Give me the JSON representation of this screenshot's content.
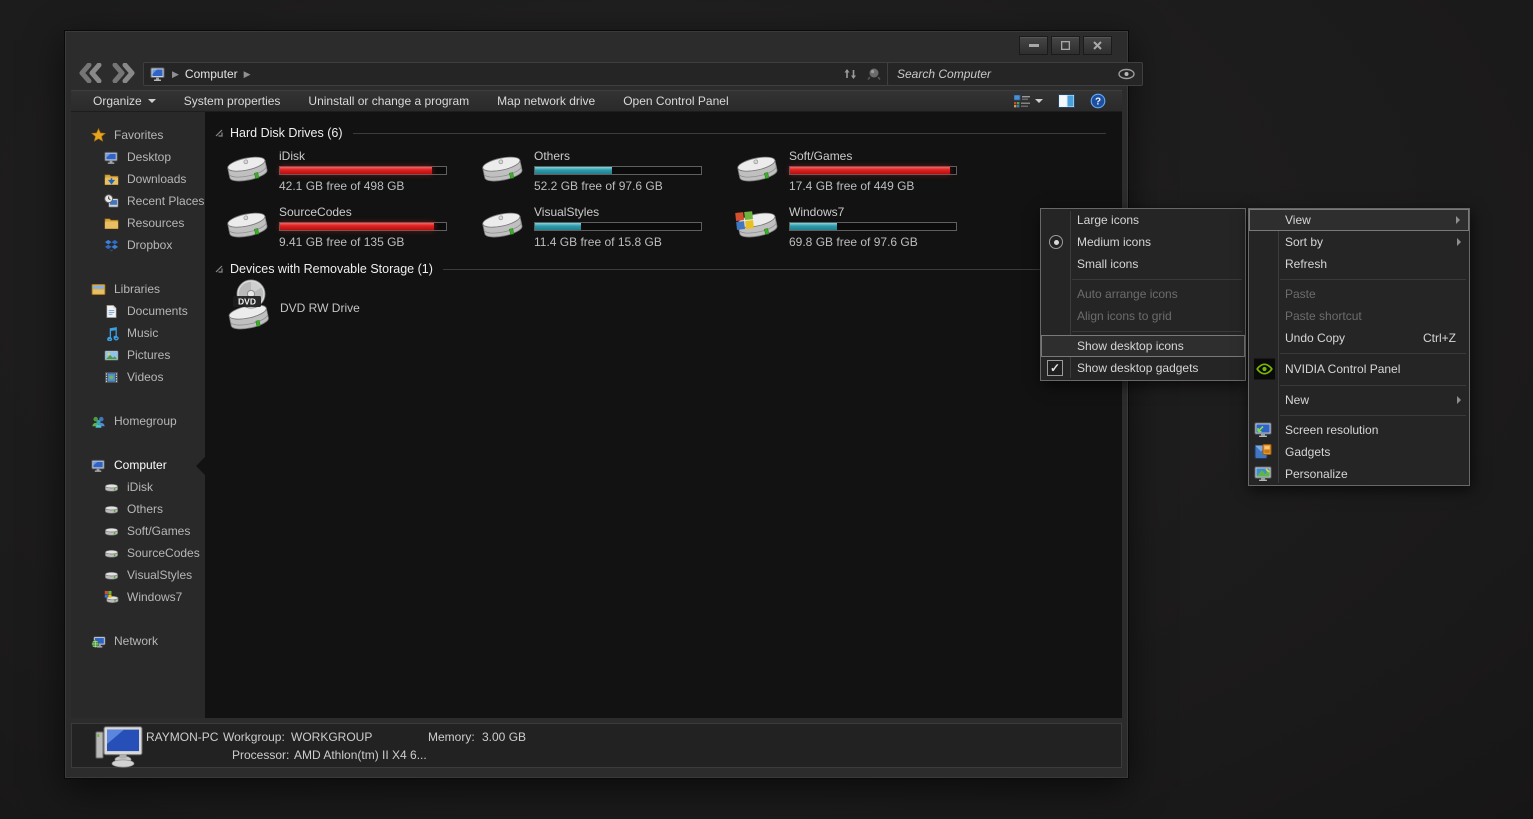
{
  "nav": {
    "breadcrumb": {
      "root_label": "Computer"
    },
    "search": {
      "placeholder": "Search Computer"
    }
  },
  "toolbar": {
    "organize": "Organize",
    "items": [
      "System properties",
      "Uninstall or change a program",
      "Map network drive",
      "Open Control Panel"
    ]
  },
  "sidebar": {
    "groups": [
      {
        "label": "Favorites",
        "items": [
          "Desktop",
          "Downloads",
          "Recent Places",
          "Resources",
          "Dropbox"
        ]
      },
      {
        "label": "Libraries",
        "items": [
          "Documents",
          "Music",
          "Pictures",
          "Videos"
        ]
      },
      {
        "label": "Homegroup",
        "items": []
      },
      {
        "label": "Computer",
        "selected": true,
        "items": [
          "iDisk",
          "Others",
          "Soft/Games",
          "SourceCodes",
          "VisualStyles",
          "Windows7"
        ]
      },
      {
        "label": "Network",
        "items": []
      }
    ]
  },
  "content": {
    "sections": [
      {
        "title": "Hard Disk Drives (6)"
      },
      {
        "title": "Devices with Removable Storage (1)"
      }
    ],
    "drives": [
      {
        "name": "iDisk",
        "free": "42.1 GB free of 498 GB",
        "bar": {
          "pct": 91.5,
          "level": "red"
        }
      },
      {
        "name": "Others",
        "free": "52.2 GB free of 97.6 GB",
        "bar": {
          "pct": 46.5,
          "level": "teal"
        }
      },
      {
        "name": "Soft/Games",
        "free": "17.4 GB free of 449 GB",
        "bar": {
          "pct": 96.1,
          "level": "red"
        }
      },
      {
        "name": "SourceCodes",
        "free": "9.41 GB free of 135 GB",
        "bar": {
          "pct": 93.0,
          "level": "red"
        }
      },
      {
        "name": "VisualStyles",
        "free": "11.4 GB free of 15.8 GB",
        "bar": {
          "pct": 27.8,
          "level": "teal"
        }
      },
      {
        "name": "Windows7",
        "free": "69.8 GB free of 97.6 GB",
        "bar": {
          "pct": 28.5,
          "level": "teal"
        }
      }
    ],
    "removable": [
      {
        "name": "DVD RW Drive"
      }
    ]
  },
  "details": {
    "computer_name": "RAYMON-PC",
    "workgroup_label": "Workgroup:",
    "workgroup": "WORKGROUP",
    "memory_label": "Memory:",
    "memory": "3.00 GB",
    "processor_label": "Processor:",
    "processor": "AMD Athlon(tm) II X4 6..."
  },
  "menus": {
    "view_submenu": {
      "items": [
        {
          "label": "Large icons"
        },
        {
          "label": "Medium icons",
          "selected_radio": true
        },
        {
          "label": "Small icons"
        },
        {
          "label": "Auto arrange icons",
          "disabled": true
        },
        {
          "label": "Align icons to grid",
          "disabled": true
        },
        {
          "label": "Show desktop icons",
          "highlighted": true
        },
        {
          "label": "Show desktop gadgets",
          "checked": true
        }
      ]
    },
    "context_menu": {
      "items": [
        {
          "label": "View",
          "submenu": true,
          "highlighted": true
        },
        {
          "label": "Sort by",
          "submenu": true
        },
        {
          "label": "Refresh"
        },
        {
          "label": "Paste",
          "disabled": true
        },
        {
          "label": "Paste shortcut",
          "disabled": true
        },
        {
          "label": "Undo Copy",
          "shortcut": "Ctrl+Z"
        },
        {
          "label": "NVIDIA Control Panel",
          "icon": "nvidia"
        },
        {
          "label": "New",
          "submenu": true
        },
        {
          "label": "Screen resolution",
          "icon": "screen-resolution"
        },
        {
          "label": "Gadgets",
          "icon": "gadgets"
        },
        {
          "label": "Personalize",
          "icon": "personalize"
        }
      ]
    }
  },
  "colors": {
    "bar_red": "#d51c1c",
    "bar_teal": "#2f98a9",
    "nvidia_green": "#76b900",
    "accent_blue": "#2f63c8"
  }
}
